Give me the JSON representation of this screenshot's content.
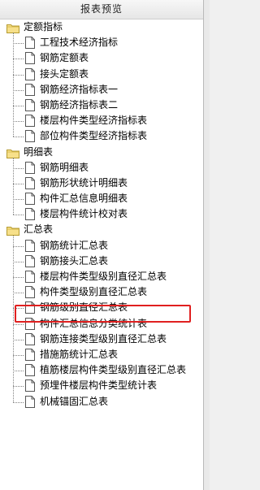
{
  "panel": {
    "title": "报表预览"
  },
  "groups": [
    {
      "label": "定额指标",
      "items": [
        "工程技术经济指标",
        "钢筋定额表",
        "接头定额表",
        "钢筋经济指标表一",
        "钢筋经济指标表二",
        "楼层构件类型经济指标表",
        "部位构件类型经济指标表"
      ]
    },
    {
      "label": "明细表",
      "items": [
        "钢筋明细表",
        "钢筋形状统计明细表",
        "构件汇总信息明细表",
        "楼层构件统计校对表"
      ]
    },
    {
      "label": "汇总表",
      "items": [
        "钢筋统计汇总表",
        "钢筋接头汇总表",
        "楼层构件类型级别直径汇总表",
        "构件类型级别直径汇总表",
        "钢筋级别直径汇总表",
        "构件汇总信息分类统计表",
        "钢筋连接类型级别直径汇总表",
        "措施筋统计汇总表",
        "植筋楼层构件类型级别直径汇总表",
        "预埋件楼层构件类型统计表",
        "机械锚固汇总表"
      ]
    }
  ],
  "highlighted_item": "植筋楼层构件类型级别直径汇总表",
  "colors": {
    "highlight_border": "#e02020",
    "folder": "#f3d66b"
  },
  "icons": {
    "group": "folder-icon",
    "item": "document-icon"
  }
}
